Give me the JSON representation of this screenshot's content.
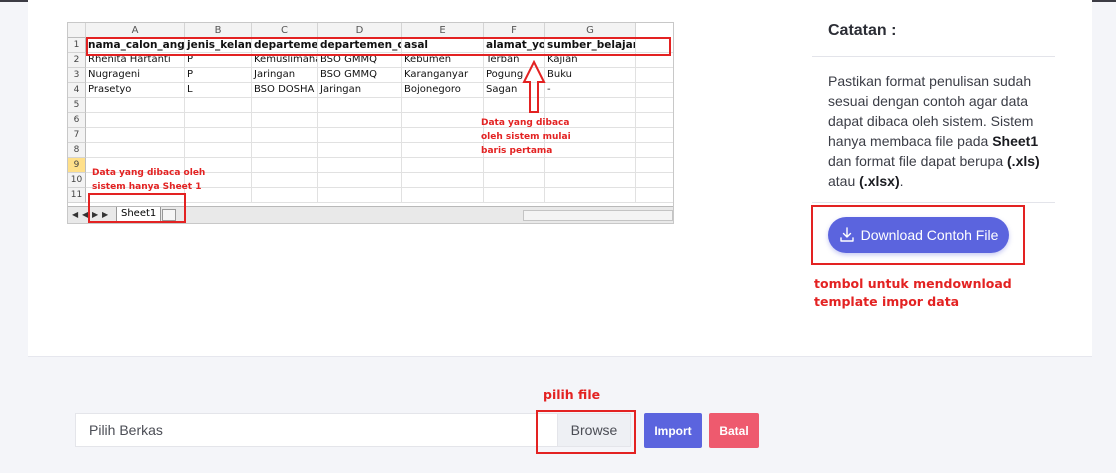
{
  "spreadsheet": {
    "columns": [
      "A",
      "B",
      "C",
      "D",
      "E",
      "F",
      "G"
    ],
    "row_numbers": [
      "1",
      "2",
      "3",
      "4",
      "5",
      "6",
      "7",
      "8",
      "9",
      "10",
      "11"
    ],
    "rows": [
      [
        "nama_calon_anggota",
        "jenis_kelamin",
        "departemen_satu",
        "departemen_dua",
        "asal",
        "alamat_yogyakarta",
        "sumber_belajar_islam"
      ],
      [
        "Rhenita Hartanti",
        "P",
        "Kemuslimahan",
        "BSO GMMQ",
        "Kebumen",
        "Terban",
        "Kajian"
      ],
      [
        "Nugrageni",
        "P",
        "Jaringan",
        "BSO GMMQ",
        "Karanganyar",
        "Pogung",
        "Buku"
      ],
      [
        "Prasetyo",
        "L",
        "BSO DOSHA",
        "Jaringan",
        "Bojonegoro",
        "Sagan",
        "-"
      ]
    ],
    "sheet_tab": "Sheet1"
  },
  "annotations": {
    "sheet_only": [
      "Data yang dibaca oleh",
      "sistem hanya Sheet 1"
    ],
    "first_row": [
      "Data yang dibaca",
      "oleh sistem mulai",
      "baris pertama"
    ],
    "download_template": [
      "tombol untuk mendownload",
      "template impor data"
    ],
    "pick_file": "pilih file"
  },
  "notes": {
    "title": "Catatan :",
    "body_intro": "Pastikan format penulisan sudah sesuai dengan contoh agar data dapat dibaca oleh sistem. Sistem hanya membaca file pada",
    "sheet_name": "Sheet1",
    "body_mid": "dan format file dapat berupa",
    "ext_xls": "(.xls)",
    "body_or": "atau",
    "ext_xlsx": "(.xlsx)",
    "body_end": "."
  },
  "download_button": {
    "label": "Download Contoh File",
    "icon": "download-icon"
  },
  "form": {
    "file_placeholder": "Pilih Berkas",
    "browse_label": "Browse",
    "import_label": "Import",
    "cancel_label": "Batal"
  },
  "colors": {
    "primary": "#5b64de",
    "danger": "#ee5a6e",
    "annotation_red": "#e32222"
  }
}
